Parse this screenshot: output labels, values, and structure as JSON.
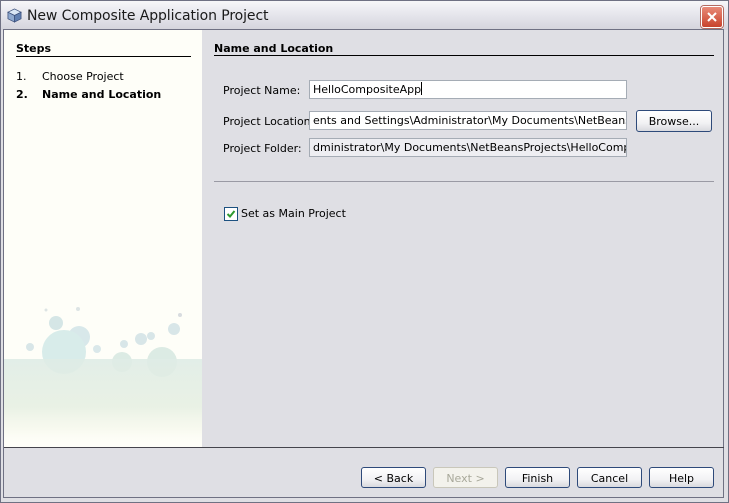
{
  "window": {
    "title": "New Composite Application Project",
    "icon": "cube-icon",
    "close_icon": "close-icon"
  },
  "steps": {
    "heading": "Steps",
    "items": [
      {
        "number": "1.",
        "label": "Choose Project",
        "current": false
      },
      {
        "number": "2.",
        "label": "Name and Location",
        "current": true
      }
    ]
  },
  "main": {
    "heading": "Name and Location",
    "fields": {
      "project_name": {
        "label": "Project Name:",
        "value": "HelloCompositeApp"
      },
      "project_location": {
        "label": "Project Location:",
        "value": "ents and Settings\\Administrator\\My Documents\\NetBeansProjects"
      },
      "project_folder": {
        "label": "Project Folder:",
        "value": "dministrator\\My Documents\\NetBeansProjects\\HelloCompositeApp"
      }
    },
    "browse_label": "Browse...",
    "set_main_project": {
      "label": "Set as Main Project",
      "checked": true
    }
  },
  "footer": {
    "back": "< Back",
    "next": "Next >",
    "finish": "Finish",
    "cancel": "Cancel",
    "help": "Help"
  },
  "colors": {
    "panel_bg": "#dfdfe4",
    "steps_bg": "#fefef8",
    "button_border": "#2e4a7a",
    "close_red": "#c8422c",
    "check_green": "#2e9a2e"
  }
}
